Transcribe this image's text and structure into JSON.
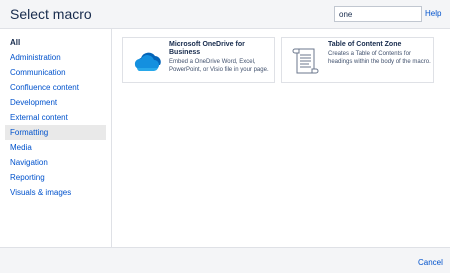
{
  "header": {
    "title": "Select macro",
    "search_value": "one",
    "help_label": "Help"
  },
  "sidebar": {
    "items": [
      {
        "label": "All"
      },
      {
        "label": "Administration"
      },
      {
        "label": "Communication"
      },
      {
        "label": "Confluence content"
      },
      {
        "label": "Development"
      },
      {
        "label": "External content"
      },
      {
        "label": "Formatting"
      },
      {
        "label": "Media"
      },
      {
        "label": "Navigation"
      },
      {
        "label": "Reporting"
      },
      {
        "label": "Visuals & images"
      }
    ]
  },
  "macros": [
    {
      "title": "Microsoft OneDrive for Business",
      "description": "Embed a OneDrive Word, Excel, PowerPoint, or Visio file in your page.",
      "icon": "onedrive-cloud-icon"
    },
    {
      "title": "Table of Content Zone",
      "description": "Creates a Table of Contents for headings within the body of the macro.",
      "icon": "scroll-document-icon"
    }
  ],
  "footer": {
    "cancel_label": "Cancel"
  },
  "colors": {
    "link": "#0052cc",
    "text": "#172b4d",
    "header_bg": "#f4f5f7",
    "selected_bg": "#e9e9e9",
    "onedrive_blue": "#0364b8"
  }
}
